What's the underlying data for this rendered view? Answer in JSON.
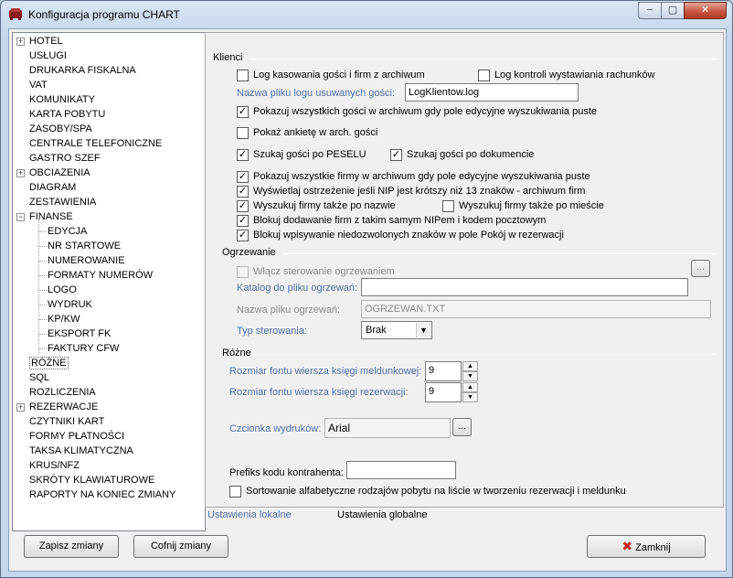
{
  "window": {
    "title": "Konfiguracja programu CHART",
    "min": "−",
    "max": "▢",
    "close": "✕"
  },
  "tree": [
    {
      "label": "HOTEL",
      "expander": "+"
    },
    {
      "label": "USŁUGI"
    },
    {
      "label": "DRUKARKA FISKALNA"
    },
    {
      "label": "VAT"
    },
    {
      "label": "KOMUNIKATY"
    },
    {
      "label": "KARTA POBYTU"
    },
    {
      "label": "ZASOBY/SPA"
    },
    {
      "label": "CENTRALE TELEFONICZNE"
    },
    {
      "label": "GASTRO SZEF"
    },
    {
      "label": "OBCIAZENIA",
      "expander": "+"
    },
    {
      "label": "DIAGRAM"
    },
    {
      "label": "ZESTAWIENIA"
    },
    {
      "label": "FINANSE",
      "expander": "−"
    },
    {
      "label": "EDYCJA",
      "child": true
    },
    {
      "label": "NR STARTOWE",
      "child": true
    },
    {
      "label": "NUMEROWANIE",
      "child": true
    },
    {
      "label": "FORMATY NUMERÓW",
      "child": true
    },
    {
      "label": "LOGO",
      "child": true
    },
    {
      "label": "WYDRUK",
      "child": true
    },
    {
      "label": "KP/KW",
      "child": true
    },
    {
      "label": "EKSPORT FK",
      "child": true
    },
    {
      "label": "FAKTURY CFW",
      "child": true
    },
    {
      "label": "RÓŻNE",
      "selected": true
    },
    {
      "label": "SQL"
    },
    {
      "label": "ROZLICZENIA"
    },
    {
      "label": "REZERWACJE",
      "expander": "+"
    },
    {
      "label": "CZYTNIKI KART"
    },
    {
      "label": "FORMY PŁATNOŚCI"
    },
    {
      "label": "TAKSA KLIMATYCZNA"
    },
    {
      "label": "KRUS/NFZ"
    },
    {
      "label": "SKRÓTY KLAWIATUROWE"
    },
    {
      "label": "RAPORTY NA KONIEC ZMIANY"
    }
  ],
  "klienci": {
    "title": "Klienci",
    "log_kasowania": {
      "label": "Log kasowania gości i firm z archiwum",
      "checked": false
    },
    "log_kontroli": {
      "label": "Log kontroli wystawiania rachunków",
      "checked": false
    },
    "plik_logu_label": "Nazwa pliku logu usuwanych gości:",
    "plik_logu_value": "LogKlientow.log",
    "pokazuj_gosci": {
      "label": "Pokazuj wszystkich gości w archiwum gdy pole edycyjne wyszukiwania puste",
      "checked": true
    },
    "pokaz_ankiete": {
      "label": "Pokaż ankietę w arch. gości",
      "checked": false
    },
    "szukaj_pesel": {
      "label": "Szukaj gości po PESELU",
      "checked": true
    },
    "szukaj_dokument": {
      "label": "Szukaj gości po dokumencie",
      "checked": true
    },
    "pokazuj_firmy": {
      "label": "Pokazuj wszystkie firmy w archiwum gdy pole edycyjne wyszukiwania puste",
      "checked": true
    },
    "ostrzezenie_nip": {
      "label": "Wyświetlaj ostrzeżenie jeśli NIP jest krótszy niż 13 znaków - archiwum firm",
      "checked": true
    },
    "firmy_nazwa": {
      "label": "Wyszukuj firmy także po nazwie",
      "checked": true
    },
    "firmy_miescie": {
      "label": "Wyszukuj firmy także po mieście",
      "checked": false
    },
    "blokuj_nip": {
      "label": "Blokuj dodawanie firm z takim samym NIPem i kodem pocztowym",
      "checked": true
    },
    "blokuj_znaki": {
      "label": "Blokuj wpisywanie niedozwolonych znaków w pole Pokój w rezerwacji",
      "checked": true
    }
  },
  "ogrzewanie": {
    "title": "Ogrzewanie",
    "wlacz": {
      "label": "Włącz sterowanie ogrzewaniem",
      "checked": false
    },
    "browse": "...",
    "katalog_label": "Katalog do pliku ogrzewań:",
    "katalog_value": "",
    "plik_label": "Nazwa pliku ogrzewań:",
    "plik_value": "OGRZEWAN.TXT",
    "typ_label": "Typ sterowania:",
    "typ_value": "Brak"
  },
  "rozne": {
    "title": "Różne",
    "font_meld_label": "Rozmiar fontu wiersza księgi meldunkowej:",
    "font_meld_value": "9",
    "font_rez_label": "Rozmiar fontu wiersza księgi rezerwacji:",
    "font_rez_value": "9",
    "czcionka_label": "Czcionka wydruków:",
    "czcionka_value": "Arial",
    "czcionka_browse": "...",
    "prefiks_label": "Prefiks kodu kontrahenta:",
    "prefiks_value": "",
    "sortowanie": {
      "label": "Sortowanie alfabetyczne rodzajów pobytu na liście w tworzeniu rezerwacji i meldunku",
      "checked": false
    }
  },
  "footer": {
    "tab_local": "Ustawienia lokalne",
    "tab_global": "Ustawienia globalne",
    "save": "Zapisz zmiany",
    "undo": "Cofnij zmiany",
    "close": "Zamknij"
  },
  "colors": {
    "link_blue": "#4a6fa7",
    "close_x": "#c8281e"
  }
}
